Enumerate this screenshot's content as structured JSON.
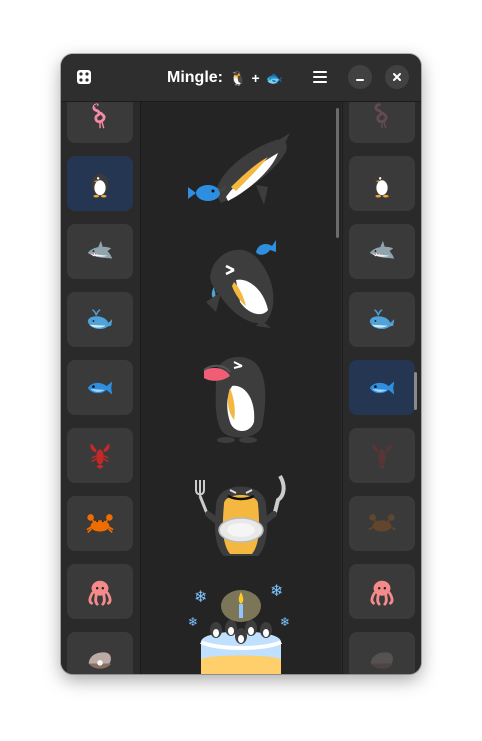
{
  "window": {
    "title": "Mingle:",
    "title_emoji_left": "🐧",
    "title_plus": "+",
    "title_emoji_right": "🐟",
    "accent": "#243651"
  },
  "headerbar": {
    "left_icon": "dice-icon",
    "menu_icon": "hamburger-menu-icon",
    "minimize_icon": "minimize-icon",
    "close_icon": "close-icon"
  },
  "left_column": {
    "items": [
      {
        "name": "flamingo",
        "selected": false
      },
      {
        "name": "penguin",
        "selected": true
      },
      {
        "name": "shark",
        "selected": false
      },
      {
        "name": "whale",
        "selected": false
      },
      {
        "name": "fish",
        "selected": false
      },
      {
        "name": "lobster",
        "selected": false
      },
      {
        "name": "crab",
        "selected": false
      },
      {
        "name": "octopus",
        "selected": false
      },
      {
        "name": "oyster",
        "selected": false
      }
    ]
  },
  "right_column": {
    "items": [
      {
        "name": "flamingo",
        "selected": false,
        "dimmed": true
      },
      {
        "name": "penguin",
        "selected": false,
        "dimmed": false
      },
      {
        "name": "shark",
        "selected": false,
        "dimmed": false
      },
      {
        "name": "whale",
        "selected": false,
        "dimmed": false
      },
      {
        "name": "fish",
        "selected": true,
        "dimmed": false
      },
      {
        "name": "lobster",
        "selected": false,
        "dimmed": true
      },
      {
        "name": "crab",
        "selected": false,
        "dimmed": true
      },
      {
        "name": "octopus",
        "selected": false,
        "dimmed": false
      },
      {
        "name": "oyster",
        "selected": false,
        "dimmed": true
      }
    ]
  },
  "results": [
    {
      "name": "penguin-diving-with-fish"
    },
    {
      "name": "penguin-laughing-with-fish"
    },
    {
      "name": "penguin-shouting"
    },
    {
      "name": "penguin-with-plate-fork-knife"
    },
    {
      "name": "penguin-birthday-cake"
    }
  ]
}
